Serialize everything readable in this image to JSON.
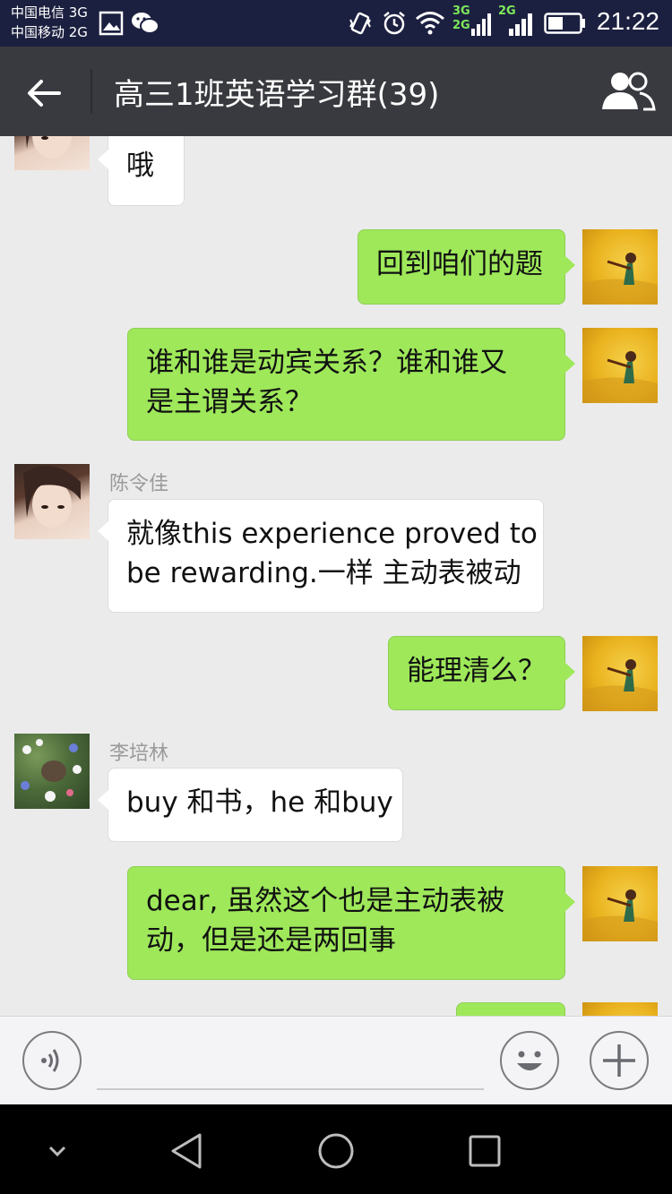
{
  "status_bar": {
    "carrier1": "中国电信 3G",
    "carrier2": "中国移动 2G",
    "net1_top": "3G",
    "net1_bottom": "2G",
    "net2": "2G",
    "time": "21:22"
  },
  "title_bar": {
    "title": "高三1班英语学习群(39)"
  },
  "messages": [
    {
      "side": "left",
      "sender": "",
      "text": "哦"
    },
    {
      "side": "right",
      "text": "回到咱们的题"
    },
    {
      "side": "right",
      "text_line1": "谁和谁是动宾关系？谁和谁又",
      "text_line2": "是主谓关系？"
    },
    {
      "side": "left",
      "sender": "陈令佳",
      "text_line1": "就像this experience proved to",
      "text_line2": "be rewarding.一样 主动表被动"
    },
    {
      "side": "right",
      "text": "能理清么？"
    },
    {
      "side": "left",
      "sender": "李培林",
      "text": "buy 和书，he 和buy"
    },
    {
      "side": "right",
      "text_line1": "dear, 虽然这个也是主动表被",
      "text_line2": "动，但是还是两回事"
    }
  ],
  "colors": {
    "status_bg": "#1c2040",
    "title_bg": "#393a3f",
    "chat_bg": "#ebebeb",
    "bubble_me": "#9ee85a",
    "bubble_other": "#ffffff"
  },
  "icons": {
    "back": "back-arrow-icon",
    "group": "group-members-icon",
    "voice": "voice-input-icon",
    "emoji": "emoji-icon",
    "plus": "plus-icon"
  }
}
